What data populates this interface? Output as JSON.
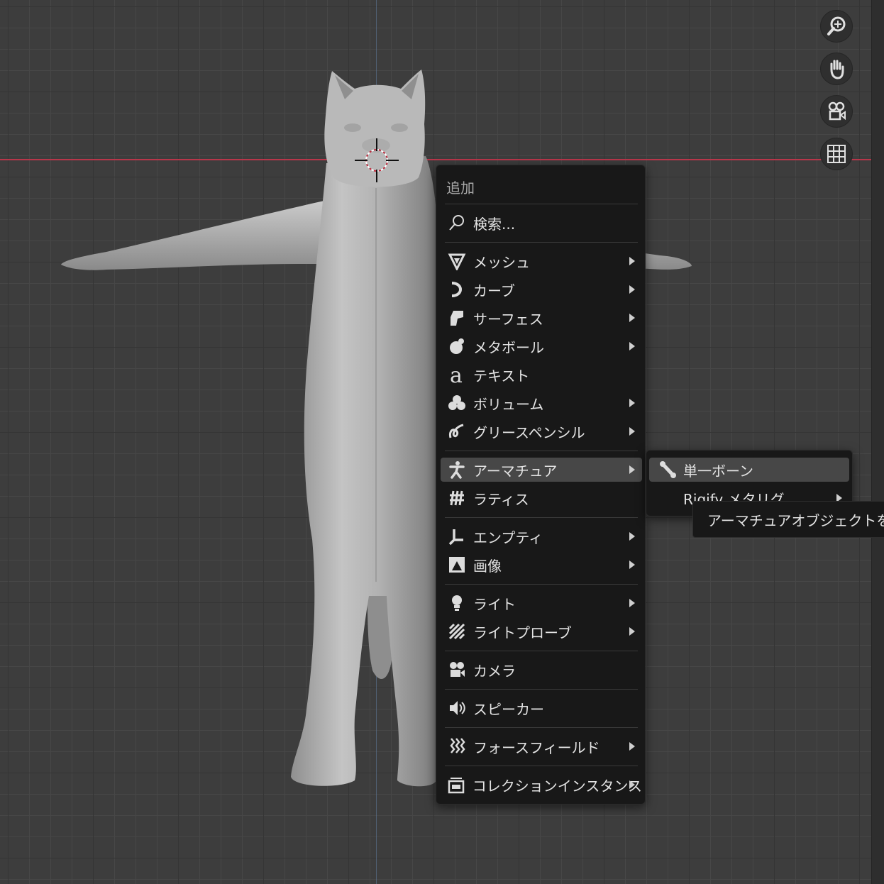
{
  "menu": {
    "title": "追加",
    "items": [
      {
        "label": "検索...",
        "icon": "search-icon"
      },
      {
        "label": "メッシュ",
        "icon": "mesh-icon"
      },
      {
        "label": "カーブ",
        "icon": "curve-icon"
      },
      {
        "label": "サーフェス",
        "icon": "surface-icon"
      },
      {
        "label": "メタボール",
        "icon": "metaball-icon"
      },
      {
        "label": "テキスト",
        "icon": "text-icon"
      },
      {
        "label": "ボリューム",
        "icon": "volume-icon"
      },
      {
        "label": "グリースペンシル",
        "icon": "grease-pencil-icon"
      },
      {
        "label": "アーマチュア",
        "icon": "armature-icon"
      },
      {
        "label": "ラティス",
        "icon": "lattice-icon"
      },
      {
        "label": "エンプティ",
        "icon": "empty-icon"
      },
      {
        "label": "画像",
        "icon": "image-icon"
      },
      {
        "label": "ライト",
        "icon": "light-icon"
      },
      {
        "label": "ライトプローブ",
        "icon": "light-probe-icon"
      },
      {
        "label": "カメラ",
        "icon": "camera-icon"
      },
      {
        "label": "スピーカー",
        "icon": "speaker-icon"
      },
      {
        "label": "フォースフィールド",
        "icon": "force-field-icon"
      },
      {
        "label": "コレクションインスタンス",
        "icon": "collection-instance-icon"
      }
    ]
  },
  "submenu": {
    "items": [
      {
        "label": "単一ボーン",
        "icon": "bone-icon"
      },
      {
        "label": "Rigify メタリグ"
      }
    ]
  },
  "tooltip": "アーマチュアオブジェクトをシ",
  "nav": [
    "zoom-icon",
    "hand-pan-icon",
    "camera-view-icon",
    "grid-ortho-icon"
  ]
}
